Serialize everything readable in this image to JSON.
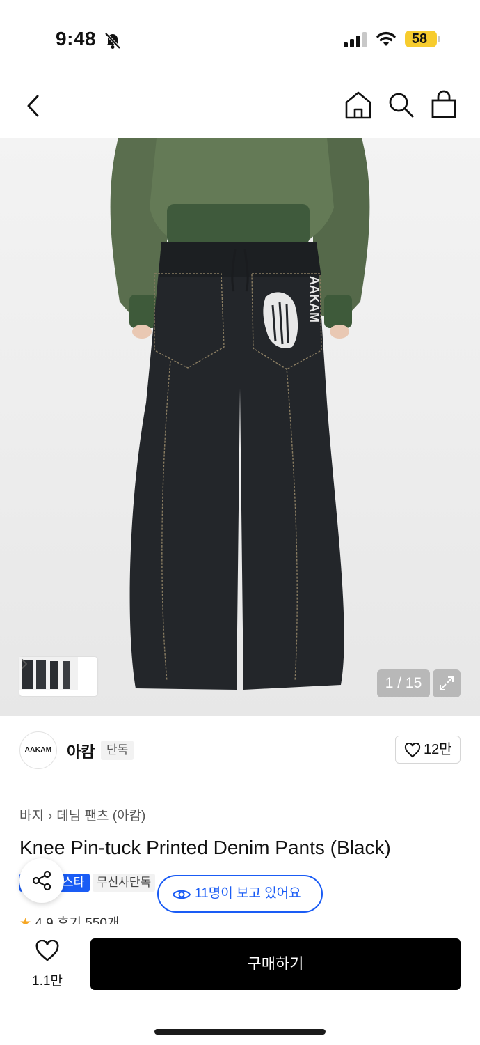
{
  "status": {
    "time": "9:48",
    "battery": "58",
    "battery_color": "#f7cc2e"
  },
  "nav": {
    "back_icon": "chevron-left-icon",
    "home_icon": "home-icon",
    "search_icon": "search-icon",
    "bag_icon": "shopping-bag-icon"
  },
  "gallery": {
    "counter": "1 / 15",
    "image_text": "AAKAM"
  },
  "brand": {
    "logo_text": "AAKAM",
    "name": "아캄",
    "tag": "단독",
    "likes": "12만"
  },
  "breadcrumb": [
    "바지",
    "데님 팬츠 (아캄)"
  ],
  "product": {
    "title": "Knee Pin-tuck Printed Denim Pants (Black)",
    "badge_primary": "스타",
    "badge_secondary": "무신사단독",
    "viewers": "11명이 보고 있어요",
    "rating": "4.9",
    "reviews": "후기 550개"
  },
  "bottom": {
    "wish_count": "1.1만",
    "buy_label": "구매하기"
  },
  "colors": {
    "accent_blue": "#1a5cf5",
    "buy_button": "#000000"
  }
}
